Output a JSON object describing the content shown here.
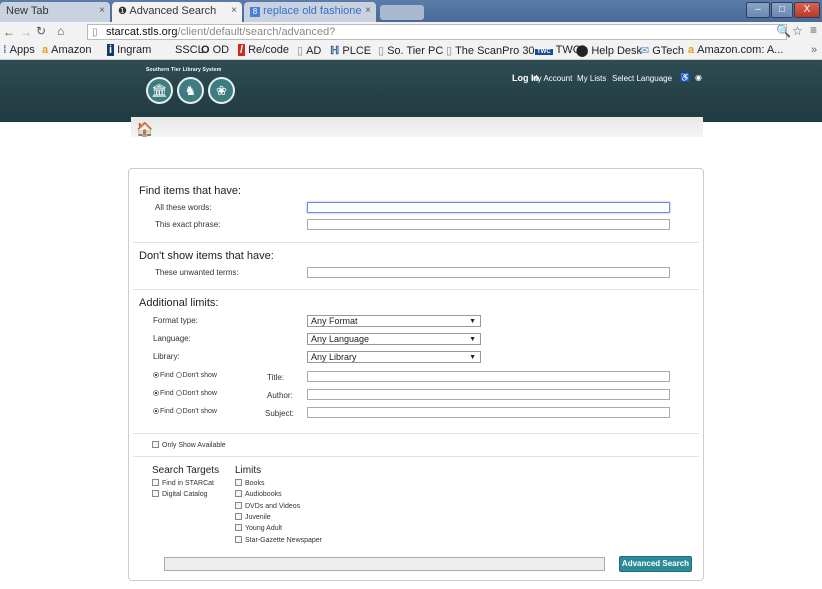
{
  "browser": {
    "tabs": [
      {
        "label": "New Tab"
      },
      {
        "label": "Advanced Search"
      },
      {
        "label": "replace old fashione"
      }
    ],
    "url_host": "starcat.stls.org",
    "url_path": "/client/default/search/advanced?",
    "bookmarks": [
      "Apps",
      "Amazon",
      "Ingram",
      "SSCL",
      "OD",
      "Re/code",
      "AD",
      "PLCE",
      "So. Tier PC",
      "The ScanPro 30...",
      "TWC",
      "Help Desk",
      "GTech",
      "Amazon.com: A..."
    ],
    "window_buttons": [
      "–",
      "□",
      "X"
    ]
  },
  "site": {
    "logo_text": "Southern Tier Library System",
    "top_links": [
      "Log In",
      "My Account",
      "My Lists",
      "Select Language"
    ]
  },
  "form": {
    "find_heading": "Find items that have:",
    "all_words_label": "All these words:",
    "exact_phrase_label": "This exact phrase:",
    "dont_show_heading": "Don't show items that have:",
    "unwanted_label": "These unwanted terms:",
    "limits_heading": "Additional limits:",
    "format_label": "Format type:",
    "format_value": "Any Format",
    "language_label": "Language:",
    "language_value": "Any Language",
    "library_label": "Library:",
    "library_value": "Any Library",
    "find_text": "Find",
    "dont_show_text": "Don't show",
    "title_label": "Title:",
    "author_label": "Author:",
    "subject_label": "Subject:",
    "only_available": "Only Show Available",
    "search_targets_heading": "Search Targets",
    "limits_col_heading": "Limits",
    "targets": [
      "Find in STARCat",
      "Digital Catalog"
    ],
    "limits": [
      "Books",
      "Audiobooks",
      "DVDs and Videos",
      "Juvenile",
      "Young Adult",
      "Star-Gazette Newspaper"
    ],
    "submit_label": "Advanced Search"
  }
}
